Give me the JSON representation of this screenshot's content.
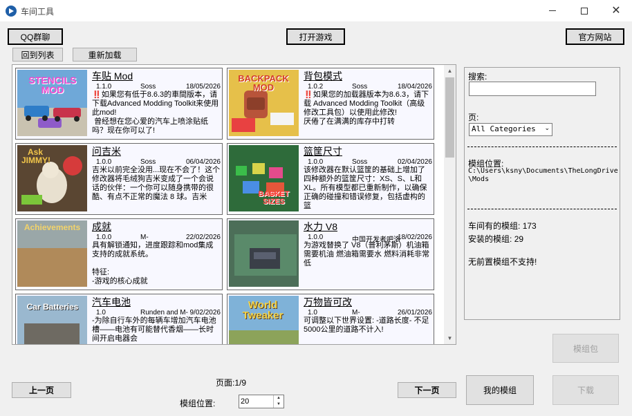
{
  "window": {
    "title": "车间工具"
  },
  "toolbar": {
    "qq_group": "QQ群聊",
    "launch_game": "打开游戏",
    "official_site": "官方网站",
    "back_to_list": "回到列表",
    "reload": "重新加载"
  },
  "mods": [
    {
      "title": "车贴 Mod",
      "version": "1.1.0",
      "author": "Soss",
      "date": "18/05/2026",
      "desc": "‼️如果您有低于8.6.3的車間版本，请下载Advanced Modding Toolkit来使用此mod!\n 曾经想在您心爱的汽车上喷涂贴纸吗？现在你可以了!",
      "thumb_text": "STENCILS MOD",
      "thumb_bg": "#6fa8d8"
    },
    {
      "title": "背包模式",
      "version": "1.0.2",
      "author": "Soss",
      "date": "18/04/2026",
      "desc": "‼️如果您的加载器版本为8.6.3，请下载 Advanced Modding Toolkit（高级修改工具包）以使用此修改!\n厌倦了在满满的库存中打转",
      "thumb_text": "BACKPACK MOD",
      "thumb_bg": "#e6c04a"
    },
    {
      "title": "问吉米",
      "version": "1.0.0",
      "author": "Soss",
      "date": "06/04/2026",
      "desc": "吉米以前完全没用...现在不会了！这个修改器将毛绒狗吉米变成了一个会说话的伙伴：一个你可以随身携带的很酷、有点不正常的魔法 8 球。吉米",
      "thumb_text": "Ask JIMMY!",
      "thumb_bg": "#5a4632"
    },
    {
      "title": "篮筐尺寸",
      "version": "1.0.0",
      "author": "Soss",
      "date": "02/04/2026",
      "desc": "该修改器在默认篮筐的基础上增加了四种额外的篮筐尺寸：XS、S、L和XL。所有模型都已重新制作，以确保正确的碰撞和错误修复，包括虚构的篮",
      "thumb_text": "BASKET SIZES",
      "thumb_bg": "#2e6b3a"
    },
    {
      "title": "成就",
      "version": "1.0.0",
      "author": "M-",
      "date": "22/02/2026",
      "desc": "具有解锁通知，进度跟踪和mod集成支持的成就系统。\n\n特征:\n-游戏的核心成就",
      "thumb_text": "Achievements",
      "thumb_bg": "#8a7a5e"
    },
    {
      "title": "水力 V8",
      "version": "1.0.0",
      "author": "中国开发者吧洛",
      "date": "18/02/2026",
      "desc": "为游戏替换了 V8（普利茅斯）机油箱需要机油 燃油箱需要水 燃料消耗非常低",
      "thumb_text": "",
      "thumb_bg": "#4c6e58"
    },
    {
      "title": "汽车电池",
      "version": "1.0",
      "author": "Runden and M-",
      "date": "9/02/2026",
      "desc": "-为除自行车外的每辆车增加汽车电池槽——电池有可能替代香烟——长时间开启电器会",
      "thumb_text": "Car Batteries",
      "thumb_bg": "#9ab8cf"
    },
    {
      "title": "万物皆可改",
      "version": "1.0",
      "author": "M-",
      "date": "26/01/2026",
      "desc": "可调整以下世界设置: -道路长度- 不足5000公里的道路不计入!",
      "thumb_text": "World Tweaker",
      "thumb_bg": "#7fb2d8"
    }
  ],
  "sidebar": {
    "search_label": "搜索:",
    "search_value": "",
    "category_label": "页:",
    "category_selected": "All Categories",
    "mod_location_label": "模组位置:",
    "mod_location_path": "C:\\Users\\ksny\\Documents\\TheLongDrive\\Mods",
    "workshop_count_label": "车间有的模组:",
    "workshop_count": "173",
    "installed_count_label": "安装的模组:",
    "installed_count": "29",
    "no_preset_text": "无前置模组不支持!"
  },
  "footer": {
    "prev_page": "上一页",
    "next_page": "下一页",
    "page_indicator": "页面:1/9",
    "mod_position_label": "模组位置:",
    "mod_position_value": "20",
    "my_mods": "我的模组",
    "mod_pack": "模组包",
    "download": "下载"
  }
}
